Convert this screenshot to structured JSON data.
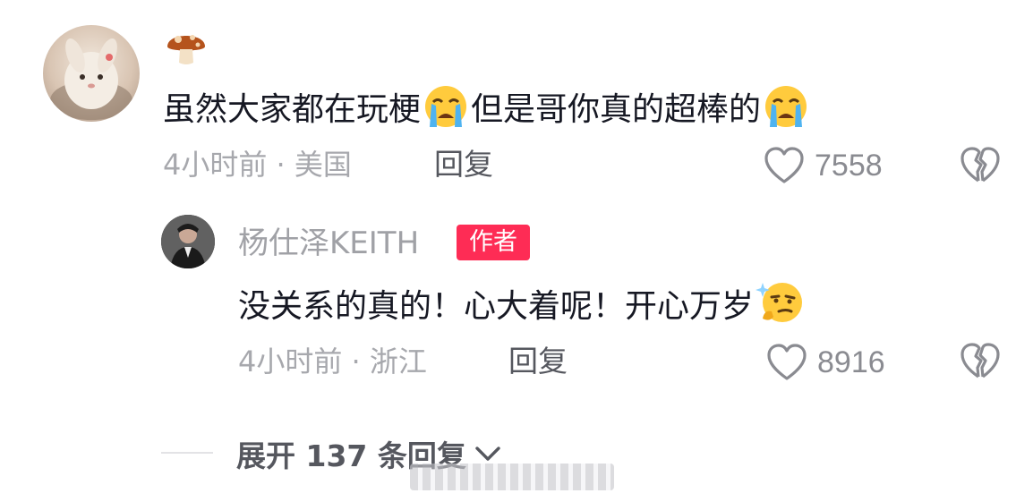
{
  "comment": {
    "text_part1": "虽然大家都在玩梗",
    "text_part2": "但是哥你真的超棒的",
    "meta": "4小时前 · 美国",
    "reply_label": "回复",
    "like_count": "7558",
    "username_icon": "mushroom-emoji",
    "inline_emoji": "loudly-crying-face-emoji"
  },
  "reply": {
    "author": "杨仕泽KEITH",
    "badge": "作者",
    "text": "没关系的真的！心大着呢！开心万岁",
    "emoji": "thinking-smirk-face-emoji",
    "meta": "4小时前 · 浙江",
    "reply_label": "回复",
    "like_count": "8916"
  },
  "expand": {
    "label": "展开 137 条回复",
    "icon": "chevron-down-icon"
  },
  "colors": {
    "text_primary": "#161823",
    "text_meta": "#a7a8ad",
    "badge_bg": "#fe2c55",
    "icon_gray": "#8a8b91"
  }
}
